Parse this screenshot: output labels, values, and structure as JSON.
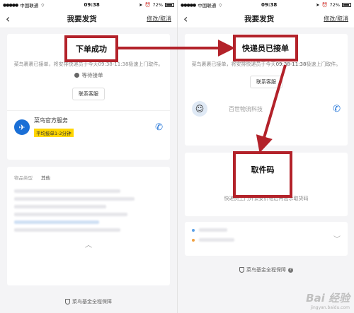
{
  "left": {
    "status": {
      "carrier": "中国联通",
      "time": "09:38",
      "battery": "72%"
    },
    "nav": {
      "back": "‹",
      "title": "我要发货",
      "action": "修改/取消"
    },
    "annotation": "下单成功",
    "info": "菜鸟裹裹已接单，将安排快递员于今天09:38-11:38极速上门取件。",
    "wait": "等待接单",
    "contact_btn": "联系客服",
    "service": {
      "name": "菜鸟官方服务",
      "badge": "平均接单1-2分钟"
    },
    "goods": {
      "label": "物品类型",
      "value": "其他"
    },
    "footer": "菜鸟基金全程保障"
  },
  "right": {
    "status": {
      "carrier": "中国联通",
      "time": "09:38",
      "battery": "72%"
    },
    "nav": {
      "back": "‹",
      "title": "我要发货",
      "action": "修改/取消"
    },
    "annotation": "快递员已接单",
    "info_pre": "菜鸟裹裹已接单，将安排快递员于今天",
    "info_time": "09:38-11:38",
    "info_post": "极速上门取件。",
    "contact_btn": "联系客服",
    "courier": {
      "company": "百世物流科技"
    },
    "pickup_code_title": "取件码",
    "pickup_note": "快递员上门并谈妥价格后再出示取货码",
    "footer": "菜鸟基金全程保障"
  },
  "watermark": {
    "brand": "Bai 经验",
    "url": "jingyan.baidu.com"
  },
  "colors": {
    "annotation_red": "#b3222a",
    "brand_blue": "#1a6fd6",
    "badge_yellow": "#ffd600"
  }
}
